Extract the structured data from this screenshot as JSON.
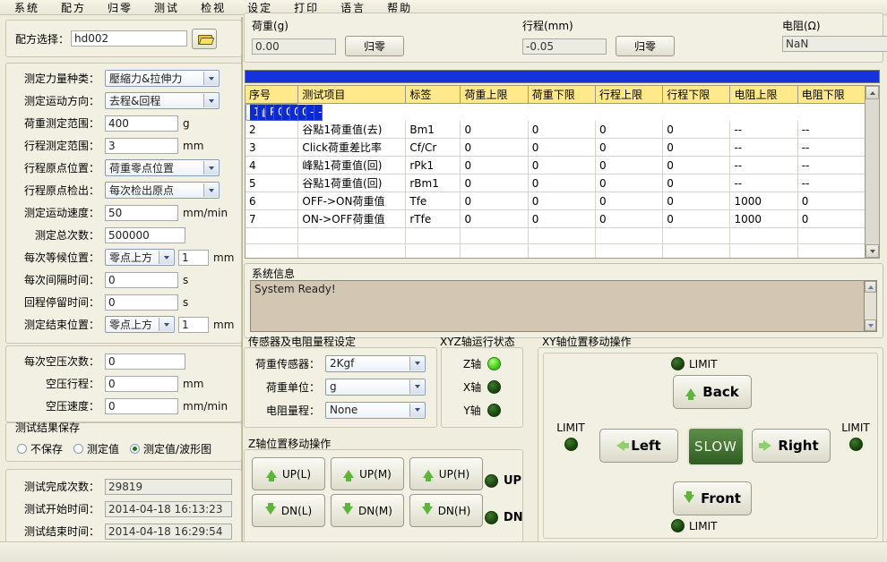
{
  "menu": {
    "items": [
      "系统",
      "配方",
      "归零",
      "测试",
      "检视",
      "设定",
      "打印",
      "语言",
      "帮助"
    ]
  },
  "recipe": {
    "label": "配方选择：",
    "value": "hd002",
    "browse_icon": "folder-open-icon"
  },
  "params": [
    {
      "label": "测定力量种类：",
      "type": "select",
      "value": "壓縮力&拉伸力",
      "unit": ""
    },
    {
      "label": "测定运动方向：",
      "type": "select",
      "value": "去程&回程",
      "unit": ""
    },
    {
      "label": "荷重测定范围：",
      "type": "text",
      "value": "400",
      "unit": "g"
    },
    {
      "label": "行程测定范围：",
      "type": "text",
      "value": "3",
      "unit": "mm"
    },
    {
      "label": "行程原点位置：",
      "type": "select",
      "value": "荷重零点位置",
      "unit": ""
    },
    {
      "label": "行程原点检出：",
      "type": "select",
      "value": "每次检出原点",
      "unit": ""
    },
    {
      "label": "测定运动速度：",
      "type": "text",
      "value": "50",
      "unit": "mm/min"
    },
    {
      "label": "测定总次数：",
      "type": "text",
      "value": "500000",
      "unit": ""
    },
    {
      "label": "每次等候位置：",
      "type": "select+text",
      "value": "零点上方",
      "value2": "1",
      "unit": "mm"
    },
    {
      "label": "每次间隔时间：",
      "type": "text",
      "value": "0",
      "unit": "s"
    },
    {
      "label": "回程停留时间：",
      "type": "text",
      "value": "0",
      "unit": "s"
    },
    {
      "label": "测定结束位置：",
      "type": "select+text",
      "value": "零点上方",
      "value2": "1",
      "unit": "mm"
    }
  ],
  "air": [
    {
      "label": "每次空压次数：",
      "value": "0",
      "unit": ""
    },
    {
      "label": "空压行程：",
      "value": "0",
      "unit": "mm"
    },
    {
      "label": "空压速度：",
      "value": "0",
      "unit": "mm/min"
    }
  ],
  "save_group": {
    "title": "测试结果保存",
    "options": [
      "不保存",
      "测定值",
      "测定值/波形图"
    ],
    "selected_index": 2
  },
  "result": [
    {
      "label": "测试完成次数：",
      "value": "29819"
    },
    {
      "label": "测试开始时间：",
      "value": "2014-04-18 16:13:23"
    },
    {
      "label": "测试结束时间：",
      "value": "2014-04-18 16:29:54"
    }
  ],
  "meters": [
    {
      "title": "荷重(g)",
      "value": "0.00",
      "button": "归零"
    },
    {
      "title": "行程(mm)",
      "value": "-0.05",
      "button": "归零"
    },
    {
      "title": "电阻(Ω)",
      "value": "NaN",
      "button": null
    }
  ],
  "table": {
    "headers": [
      "序号",
      "测试项目",
      "标签",
      "荷重上限",
      "荷重下限",
      "行程上限",
      "行程下限",
      "电阻上限",
      "电阻下限"
    ],
    "rows": [
      [
        "1",
        "峰點1荷重值(去)",
        "Pk1",
        "0",
        "0",
        "0",
        "0",
        "--",
        "--"
      ],
      [
        "2",
        "谷點1荷重值(去)",
        "Bm1",
        "0",
        "0",
        "0",
        "0",
        "--",
        "--"
      ],
      [
        "3",
        "Click荷重差比率",
        "Cf/Cr",
        "0",
        "0",
        "0",
        "0",
        "--",
        "--"
      ],
      [
        "4",
        "峰點1荷重值(回)",
        "rPk1",
        "0",
        "0",
        "0",
        "0",
        "--",
        "--"
      ],
      [
        "5",
        "谷點1荷重值(回)",
        "rBm1",
        "0",
        "0",
        "0",
        "0",
        "--",
        "--"
      ],
      [
        "6",
        "OFF->ON荷重值",
        "Tfe",
        "0",
        "0",
        "0",
        "0",
        "1000",
        "0"
      ],
      [
        "7",
        "ON->OFF荷重值",
        "rTfe",
        "0",
        "0",
        "0",
        "0",
        "1000",
        "0"
      ]
    ],
    "selected_row": 0,
    "empty_rows": 5
  },
  "system_info": {
    "title": "系统信息",
    "text": "System Ready!"
  },
  "sensor_group": {
    "title": "传感器及电阻量程设定",
    "rows": [
      {
        "label": "荷重传感器：",
        "value": "2Kgf"
      },
      {
        "label": "荷重单位：",
        "value": "g"
      },
      {
        "label": "电阻量程：",
        "value": "None"
      }
    ]
  },
  "xyz_status": {
    "title": "XYZ轴运行状态",
    "axes": [
      {
        "label": "Z轴",
        "state": "on"
      },
      {
        "label": "X轴",
        "state": "off"
      },
      {
        "label": "Y轴",
        "state": "off"
      }
    ]
  },
  "z_axis": {
    "title": "Z轴位置移动操作",
    "buttons": [
      "UP(L)",
      "UP(M)",
      "UP(H)",
      "DN(L)",
      "DN(M)",
      "DN(H)"
    ],
    "leds": [
      {
        "label": "UP",
        "state": "off"
      },
      {
        "label": "DN",
        "state": "off"
      }
    ]
  },
  "xy_axis": {
    "title": "XY轴位置移动操作",
    "buttons": {
      "back": "Back",
      "left": "Left",
      "right": "Right",
      "front": "Front",
      "speed": "SLOW"
    },
    "limits": [
      {
        "label": "LIMIT",
        "position": "top",
        "state": "off"
      },
      {
        "label": "LIMIT",
        "position": "left",
        "state": "off"
      },
      {
        "label": "LIMIT",
        "position": "right",
        "state": "off"
      },
      {
        "label": "LIMIT",
        "position": "bottom",
        "state": "off"
      }
    ]
  },
  "colors": {
    "accent_blue": "#1433dd",
    "header_yellow": "#ffe98a",
    "panel_bg": "#eeedde",
    "led_on": "#3fd11a",
    "led_off": "#17400d",
    "slow_green": "#2f5c21"
  }
}
